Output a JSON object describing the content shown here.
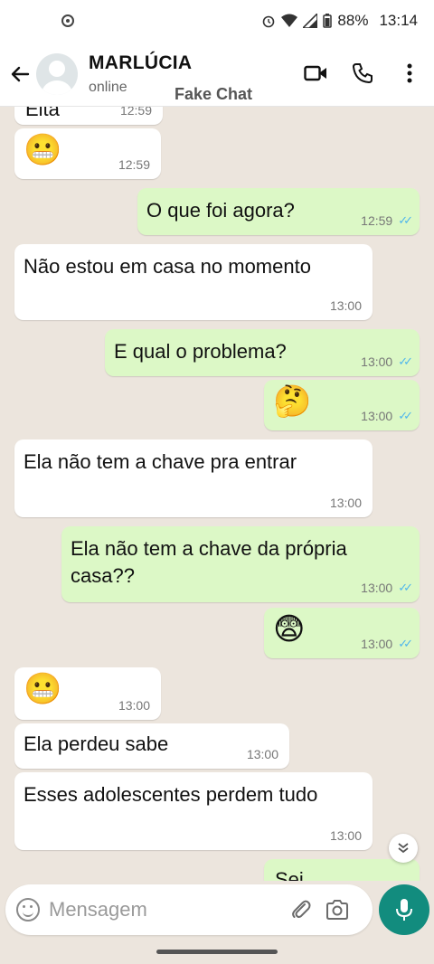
{
  "status_bar": {
    "battery": "88%",
    "time": "13:14",
    "icons": [
      "location-icon",
      "alarm-icon",
      "wifi-icon",
      "signal-icon",
      "battery-icon"
    ]
  },
  "header": {
    "name": "MARLÚCIA",
    "status": "online",
    "watermark": "Fake Chat",
    "icons": [
      "back-arrow-icon",
      "video-call-icon",
      "phone-icon",
      "more-vert-icon"
    ]
  },
  "messages": [
    {
      "dir": "in",
      "text": "Eita",
      "time": "12:59",
      "partial": true
    },
    {
      "dir": "in",
      "text": "😬",
      "time": "12:59",
      "emoji": true
    },
    {
      "dir": "out",
      "text": "O que foi agora?",
      "time": "12:59"
    },
    {
      "dir": "in",
      "text": "Não estou em casa no momento",
      "time": "13:00"
    },
    {
      "dir": "out",
      "text": "E qual o problema?",
      "time": "13:00"
    },
    {
      "dir": "out",
      "text": "🤔",
      "time": "13:00",
      "emoji": true
    },
    {
      "dir": "in",
      "text": "Ela não tem a chave pra entrar",
      "time": "13:00"
    },
    {
      "dir": "out",
      "text": "Ela não tem a chave da própria casa??",
      "time": "13:00"
    },
    {
      "dir": "out",
      "text": "😨",
      "time": "13:00",
      "emoji": true
    },
    {
      "dir": "in",
      "text": "😬",
      "time": "13:00",
      "emoji": true
    },
    {
      "dir": "in",
      "text": "Ela perdeu sabe",
      "time": "13:00"
    },
    {
      "dir": "in",
      "text": "Esses adolescentes perdem tudo",
      "time": "13:00"
    },
    {
      "dir": "out",
      "text": "Sei",
      "time": "",
      "partial": true
    }
  ],
  "composer": {
    "placeholder": "Mensagem",
    "icons": [
      "emoji-icon",
      "attach-icon",
      "camera-icon",
      "mic-icon"
    ]
  },
  "colors": {
    "incoming_bubble": "#ffffff",
    "outgoing_bubble": "#dcf8c6",
    "read_ticks": "#4fb6ec",
    "mic_button": "#128c7e",
    "chat_background": "#ece5dd"
  }
}
